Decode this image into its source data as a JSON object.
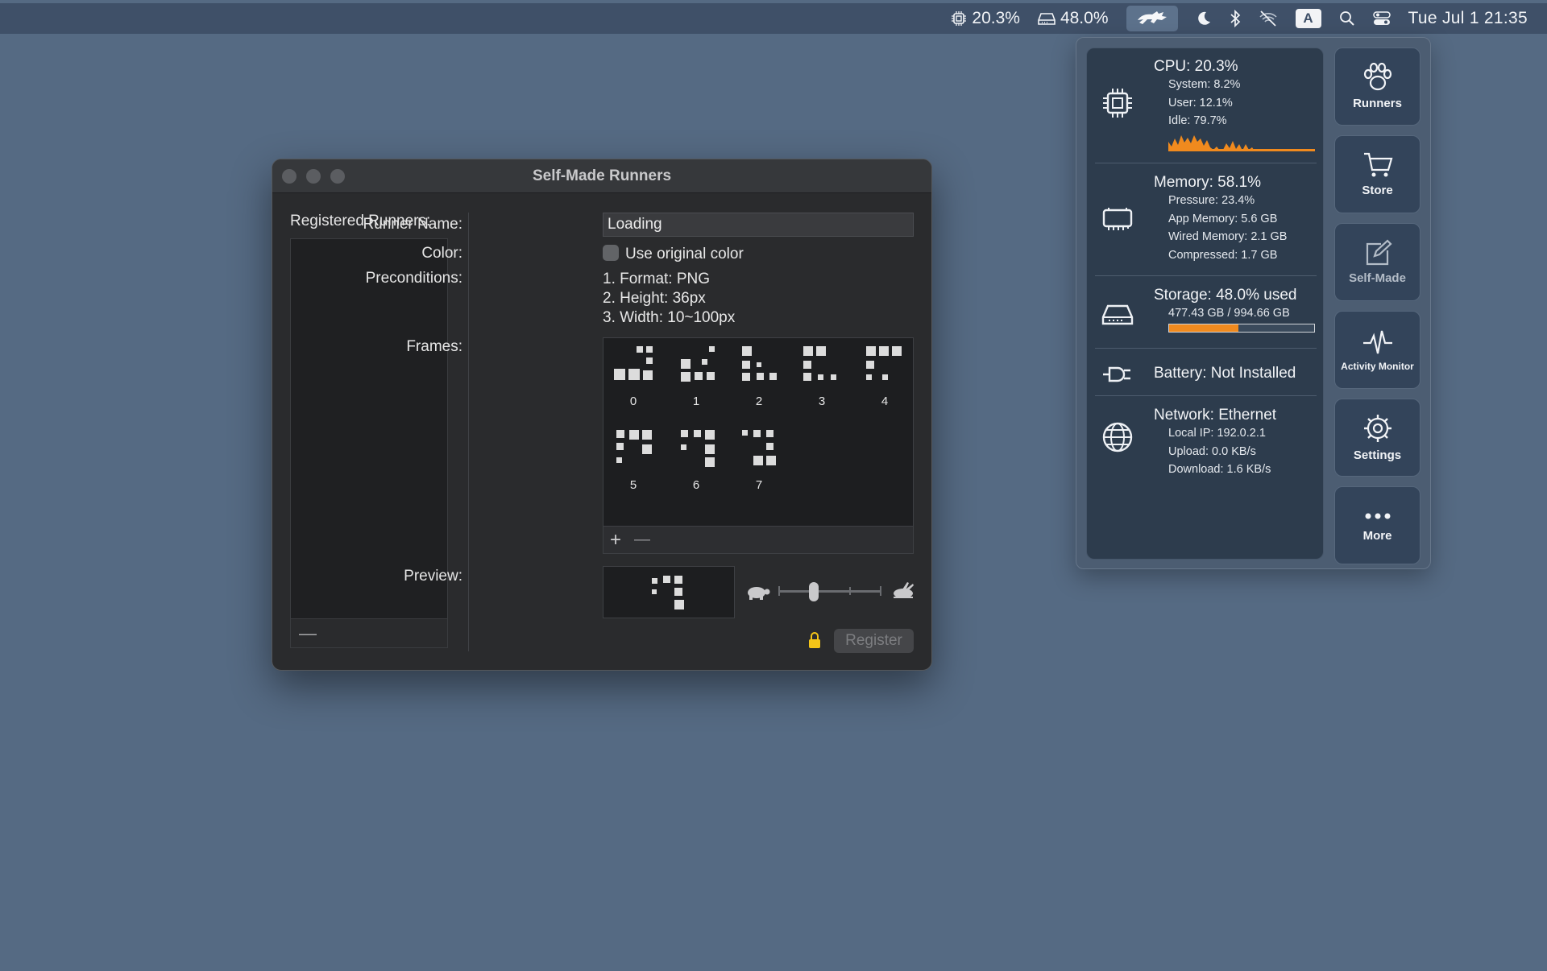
{
  "menubar": {
    "cpu": "20.3%",
    "storage": "48.0%",
    "clock": "Tue Jul 1  21:35",
    "input_source": "A"
  },
  "window": {
    "title": "Self-Made Runners",
    "registered_label": "Registered Runners:",
    "list_minus": "—",
    "name_label": "Runner Name:",
    "name_value": "Loading",
    "color_label": "Color:",
    "color_checkbox": "Use original color",
    "pre_label": "Preconditions:",
    "preconditions": [
      "1. Format: PNG",
      "2. Height: 36px",
      "3. Width: 10~100px"
    ],
    "frames_label": "Frames:",
    "frames": [
      "0",
      "1",
      "2",
      "3",
      "4",
      "5",
      "6",
      "7"
    ],
    "add_frame": "+",
    "remove_frame": "—",
    "preview_label": "Preview:",
    "register": "Register"
  },
  "stats": {
    "cpu": {
      "title": "CPU: 20.3%",
      "system": "System:  8.2%",
      "user": "User: 12.1%",
      "idle": "Idle: 79.7%"
    },
    "memory": {
      "title": "Memory: 58.1%",
      "pressure": "Pressure: 23.4%",
      "app": "App Memory:  5.6 GB",
      "wired": "Wired Memory:  2.1 GB",
      "compressed": "Compressed:  1.7 GB"
    },
    "storage": {
      "title": "Storage: 48.0% used",
      "detail": "477.43 GB / 994.66 GB",
      "used_fraction": 0.48
    },
    "battery": {
      "title": "Battery: Not Installed"
    },
    "network": {
      "title": "Network: Ethernet",
      "ip": "Local IP: 192.0.2.1",
      "upload": "Upload:   0.0 KB/s",
      "download": "Download:   1.6 KB/s"
    }
  },
  "quick": [
    "Runners",
    "Store",
    "Self-Made",
    "Activity Monitor",
    "Settings",
    "More"
  ],
  "colors": {
    "accent": "#f08a1e",
    "menubar": "#3f5068",
    "desktop": "#556a83"
  }
}
